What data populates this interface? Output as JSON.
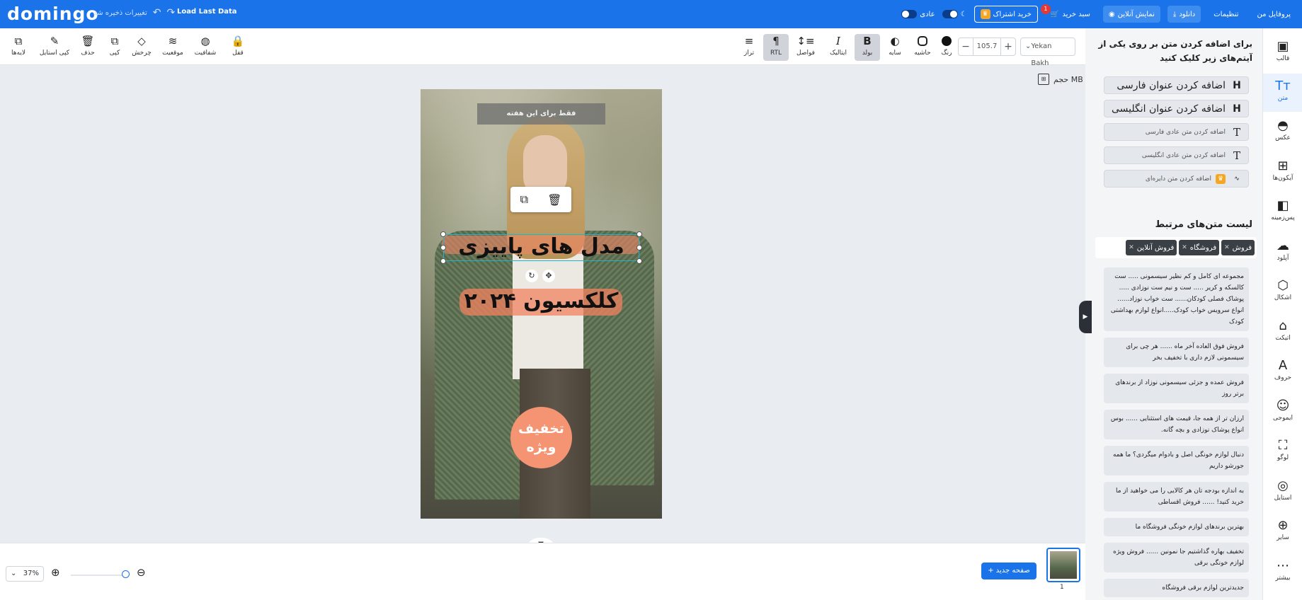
{
  "app": {
    "logo": "domingo",
    "unsaved": "تغییرات ذخیره شد",
    "load_last": "Load Last Data"
  },
  "topbar": {
    "profile": "پروفایل من",
    "settings": "تنظیمات",
    "download": "دانلود",
    "preview": "نمایش آنلاین",
    "cart": "سبد خرید",
    "cart_count": "1",
    "subscribe": "خرید اشتراک",
    "mode_label": "عادی"
  },
  "toolbar": {
    "font": "Yekan Bakh",
    "size": "105.7",
    "color": "رنگ",
    "stroke": "حاشیه",
    "shadow": "سایه",
    "bold": "بولد",
    "italic": "ایتالیک",
    "spacing": "فواصل",
    "rtl": "RTL",
    "align": "تراز",
    "lock": "قفل",
    "opacity": "شفافیت",
    "position": "موقعیت",
    "rotate": "چرخش",
    "copy": "کپی",
    "delete": "حذف",
    "copy_style": "کپی استایل",
    "layers": "لایه‌ها"
  },
  "canvas": {
    "size_label": "حجم MB",
    "badge_top": "فقط برای این هفته",
    "title": "مدل های پاییزی",
    "subtitle": "کلکسیون ۲۰۲۴",
    "circle_line1": "تخفیف",
    "circle_line2": "ویژه"
  },
  "bottom": {
    "zoom": "37%",
    "new_page": "صفحه جدید",
    "page_num": "1"
  },
  "panel": {
    "heading": "برای اضافه کردن متن بر روی یکی از آیتم‌های زیر کلیک کنید",
    "btn_fa_title": "اضافه کردن عنوان فارسی",
    "btn_en_title": "اضافه کردن عنوان انگلیسی",
    "btn_fa_text": "اضافه کردن متن عادی فارسی",
    "btn_en_text": "اضافه کردن متن عادی انگلیسی",
    "btn_circle": "اضافه کردن متن دایره‌ای",
    "related_title": "لیست متن‌های مرتبط",
    "tags": [
      "فروش",
      "فروشگاه",
      "فروش آنلاین"
    ],
    "items": [
      "مجموعه ای کامل و کم نظیر سیسمونی ..... ست کالسکه و کریر ..... ست و نیم ست نوزادی ..... پوشاک فصلی کودکان...... ست خواب نوزاد...... انواع سرویس خواب کودک.....انواع لوازم بهداشتی کودک",
      "فروش فوق العاده آخر ماه ...... هر چی برای سیسمونی لازم داری با تخفیف بخر",
      "فروش عمده و جزئی سیسمونی نوزاد از برندهای برتر روز",
      "ارزان تر از همه جا، قیمت های استثنایی ...... بوس انواع پوشاک نوزادی و بچه گانه.",
      "دنبال لوازم خونگی اصل و بادوام میگردی؟ ما همه جورشو داریم",
      "به اندازه بودجه تان هر کالایی را می خواهید از ما خرید کنید! ...... فروش اقساطی",
      "بهترین برندهای لوازم خونگی فروشگاه ما",
      "تخفیف بهاره گذاشتیم جا نمونین ...... فروش ویژه لوازم خونگی برقی",
      "جدیدترین لوازم برقی فروشگاه"
    ]
  },
  "rail": [
    {
      "label": "قالب",
      "icon": "▣"
    },
    {
      "label": "متن",
      "icon": "Tт"
    },
    {
      "label": "عکس",
      "icon": "◓"
    },
    {
      "label": "آیکون‌ها",
      "icon": "⊞"
    },
    {
      "label": "پس‌زمینه",
      "icon": "◧"
    },
    {
      "label": "آپلود",
      "icon": "☁"
    },
    {
      "label": "اشکال",
      "icon": "⬡"
    },
    {
      "label": "اتیکت",
      "icon": "⌂"
    },
    {
      "label": "حروف",
      "icon": "A"
    },
    {
      "label": "ایموجی",
      "icon": "☺"
    },
    {
      "label": "لوگو",
      "icon": "⛶"
    },
    {
      "label": "استایل",
      "icon": "◎"
    },
    {
      "label": "سایر",
      "icon": "⊕"
    },
    {
      "label": "بیشتر",
      "icon": "⋯"
    }
  ]
}
